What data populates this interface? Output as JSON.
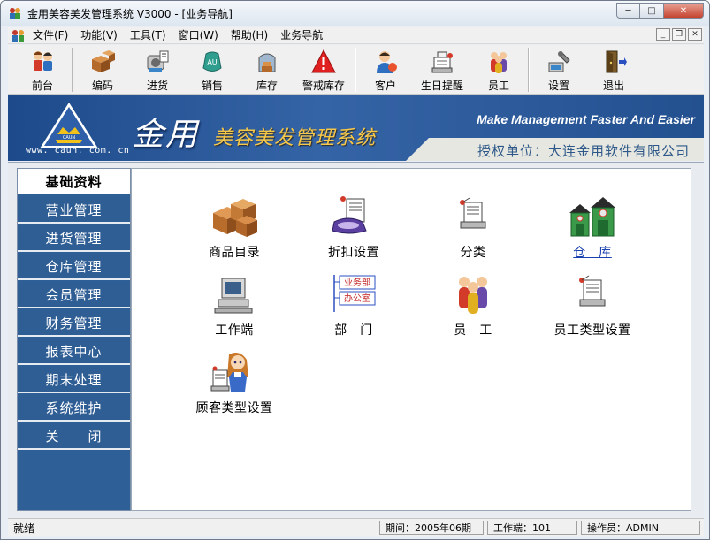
{
  "window": {
    "title": "金用美容美发管理系统 V3000 - [业务导航]",
    "buttons": {
      "minimize": "─",
      "maximize": "□",
      "close": "✕"
    }
  },
  "menubar": {
    "items": [
      {
        "label": "文件(F)"
      },
      {
        "label": "功能(V)"
      },
      {
        "label": "工具(T)"
      },
      {
        "label": "窗口(W)"
      },
      {
        "label": "帮助(H)"
      },
      {
        "label": "业务导航"
      }
    ],
    "mdi_buttons": {
      "minimize": "_",
      "restore": "❐",
      "close": "✕"
    }
  },
  "toolbar": {
    "items": [
      {
        "label": "前台",
        "icon": "people-icon"
      },
      {
        "label": "编码",
        "icon": "boxes-icon"
      },
      {
        "label": "进货",
        "icon": "purchase-icon"
      },
      {
        "label": "销售",
        "icon": "sales-icon"
      },
      {
        "label": "库存",
        "icon": "inventory-icon"
      },
      {
        "label": "警戒库存",
        "icon": "warning-icon"
      },
      {
        "label": "客户",
        "icon": "customer-icon"
      },
      {
        "label": "生日提醒",
        "icon": "birthday-icon"
      },
      {
        "label": "员工",
        "icon": "staff-icon"
      },
      {
        "label": "设置",
        "icon": "settings-icon"
      },
      {
        "label": "退出",
        "icon": "exit-icon"
      }
    ]
  },
  "banner": {
    "logo_text": "CAUN",
    "url": "www. caun. com. cn",
    "brand": "金用",
    "system_name": "美容美发管理系统",
    "slogan": "Make Management Faster And Easier",
    "license": "授权单位：大连金用软件有限公司",
    "colors": {
      "background": "#27508e",
      "system_name": "#f6c84a",
      "license": "#2c5788"
    }
  },
  "sidenav": {
    "items": [
      {
        "label": "基础资料",
        "active": true
      },
      {
        "label": "营业管理"
      },
      {
        "label": "进货管理"
      },
      {
        "label": "仓库管理"
      },
      {
        "label": "会员管理"
      },
      {
        "label": "财务管理"
      },
      {
        "label": "报表中心"
      },
      {
        "label": "期末处理"
      },
      {
        "label": "系统维护"
      },
      {
        "label": "关　　闭"
      }
    ]
  },
  "content": {
    "items": [
      {
        "label": "商品目录",
        "icon": "boxes-icon"
      },
      {
        "label": "折扣设置",
        "icon": "discount-icon"
      },
      {
        "label": "分类",
        "icon": "category-icon"
      },
      {
        "label": "仓　库",
        "icon": "warehouse-icon",
        "link": true
      },
      {
        "label": "工作端",
        "icon": "computer-icon"
      },
      {
        "label": "部　门",
        "icon": "department-icon",
        "dept_tags": [
          "业务部",
          "办公室"
        ]
      },
      {
        "label": "员　工",
        "icon": "staff-icon"
      },
      {
        "label": "员工类型设置",
        "icon": "staff-type-icon"
      },
      {
        "label": "顾客类型设置",
        "icon": "customer-type-icon"
      }
    ]
  },
  "statusbar": {
    "status": "就绪",
    "period": "期间：2005年06期",
    "workstation": "工作端：101",
    "operator": "操作员：ADMIN"
  }
}
